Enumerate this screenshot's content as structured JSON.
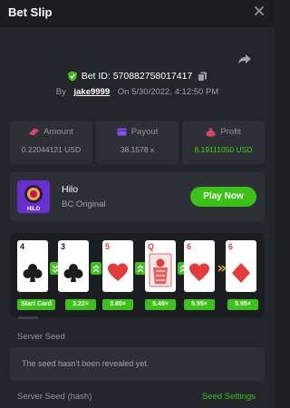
{
  "header": {
    "title": "Bet Slip",
    "close_icon": "close-icon"
  },
  "bet": {
    "id_label": "Bet ID: 570882758017417",
    "by_label": "By",
    "username": "jake9999",
    "on_label": "On 5/30/2022, 4:12:50 PM"
  },
  "stats": [
    {
      "label": "Amount",
      "value": "0.22044121 USD",
      "icon": "coins-icon",
      "color": "#e0416b"
    },
    {
      "label": "Payout",
      "value": "38.1578 x",
      "icon": "card-icon",
      "color": "#8a4cf0"
    },
    {
      "label": "Profit",
      "value": "8.19111050 USD",
      "icon": "money-bag-icon",
      "color": "#e0416b"
    }
  ],
  "game": {
    "name": "Hilo",
    "provider": "BC Original",
    "play_label": "Play Now",
    "thumb_label": "HILO"
  },
  "cards": [
    {
      "rank": "4",
      "suit": "clubs",
      "color": "black",
      "multiplier": "Start Card"
    },
    {
      "rank": "3",
      "suit": "clubs",
      "color": "black",
      "multiplier": "3.22×"
    },
    {
      "rank": "5",
      "suit": "hearts",
      "color": "red",
      "multiplier": "3.80×"
    },
    {
      "rank": "Q",
      "suit": "face",
      "color": "red",
      "multiplier": "5.49×"
    },
    {
      "rank": "6",
      "suit": "hearts",
      "color": "red",
      "multiplier": "5.95×"
    },
    {
      "rank": "6",
      "suit": "diamonds",
      "color": "red",
      "multiplier": "5.95×"
    }
  ],
  "seeds": {
    "server_label": "Server Seed",
    "server_value": "The seed hasn't been revealed yet.",
    "hash_label": "Server Seed (hash)",
    "settings_label": "Seed Settings"
  },
  "colors": {
    "accent": "#3bc117",
    "background": "#1e2024",
    "panel": "#24262b"
  }
}
